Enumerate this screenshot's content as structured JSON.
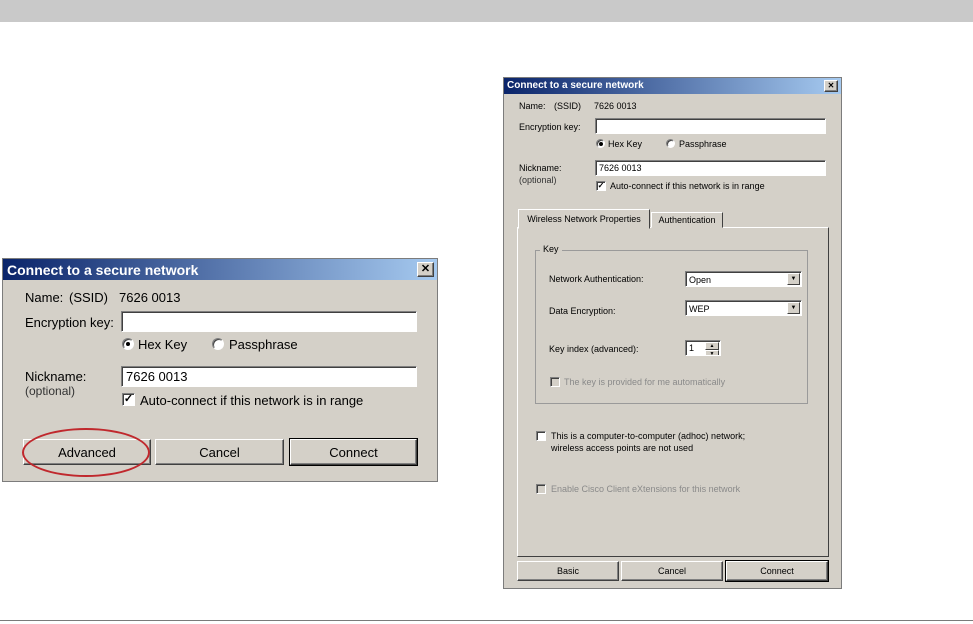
{
  "small_dialog": {
    "title": "Connect to a secure network",
    "close_glyph": "✕",
    "name_label": "Name:",
    "ssid_label": "(SSID)",
    "ssid_value": "7626 0013",
    "encryption_key_label": "Encryption key:",
    "encryption_key_value": "",
    "radio_hex_label": "Hex Key",
    "radio_passphrase_label": "Passphrase",
    "nickname_label": "Nickname:",
    "optional_label": "(optional)",
    "nickname_value": "7626 0013",
    "autoconnect_label": "Auto-connect if this network is in range",
    "check_glyph": "✓",
    "advanced_button": "Advanced",
    "cancel_button": "Cancel",
    "connect_button": "Connect"
  },
  "large_dialog": {
    "title": "Connect to a secure network",
    "close_glyph": "✕",
    "name_label": "Name:",
    "ssid_label": "(SSID)",
    "ssid_value": "7626 0013",
    "encryption_key_label": "Encryption key:",
    "encryption_key_value": "",
    "radio_hex_label": "Hex Key",
    "radio_passphrase_label": "Passphrase",
    "nickname_label": "Nickname:",
    "optional_label": "(optional)",
    "nickname_value": "7626 0013",
    "autoconnect_label": "Auto-connect if this network is in range",
    "check_glyph": "✓",
    "tabs": [
      "Wireless Network Properties",
      "Authentication"
    ],
    "key_group_title": "Key",
    "network_auth_label": "Network Authentication:",
    "network_auth_value": "Open",
    "data_encryption_label": "Data Encryption:",
    "data_encryption_value": "WEP",
    "key_index_label": "Key index (advanced):",
    "key_index_value": "1",
    "key_provided_label": "The key is provided for me automatically",
    "adhoc_label_line1": "This is a computer-to-computer (adhoc) network;",
    "adhoc_label_line2": "wireless access points are not used",
    "cisco_label": "Enable Cisco Client eXtensions for this network",
    "basic_button": "Basic",
    "cancel_button": "Cancel",
    "connect_button": "Connect",
    "arrow_glyph": "▼",
    "spin_up_glyph": "▲",
    "spin_down_glyph": "▼"
  },
  "colors": {
    "dialog_face": "#d4d0c8",
    "title_gradient_start": "#0a246a",
    "title_gradient_end": "#a6caf0",
    "highlight_ellipse": "#c0282d"
  }
}
